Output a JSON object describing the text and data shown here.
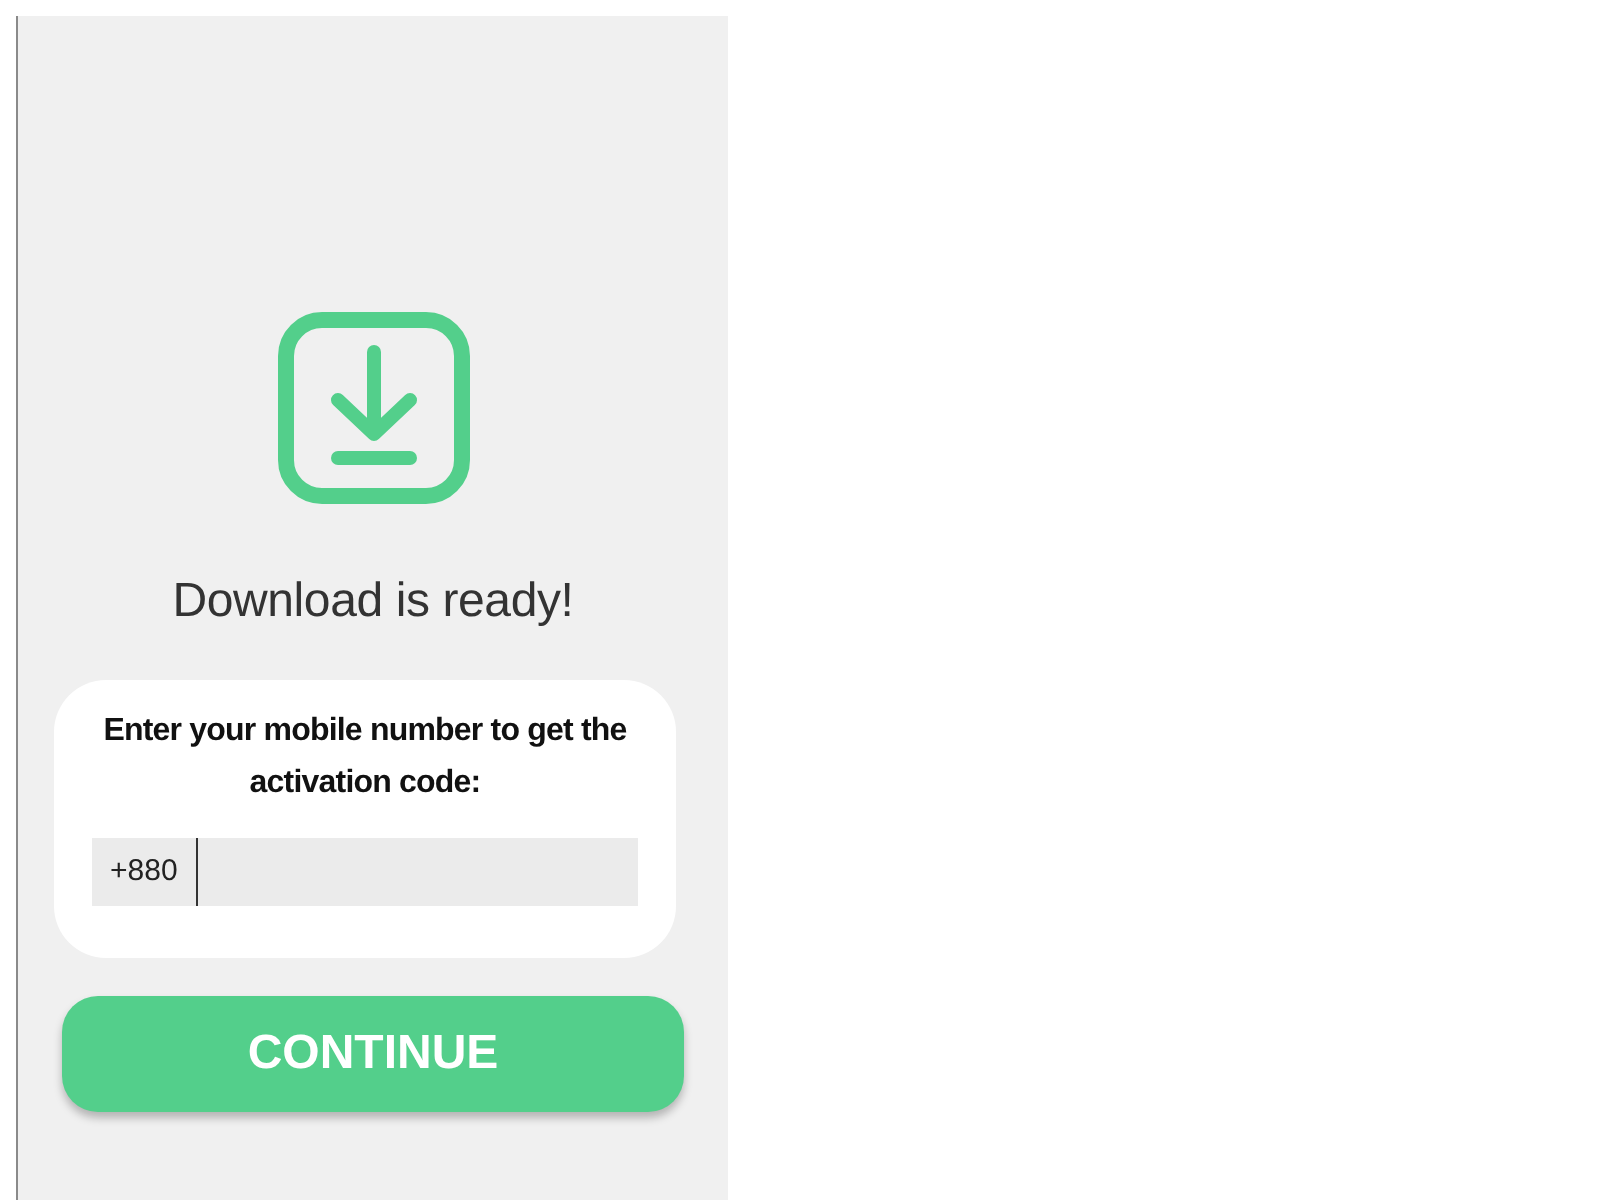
{
  "title": "Download is ready!",
  "form": {
    "prompt": "Enter your mobile number to get the activation code:",
    "phone_field": {
      "prefix": "+880"
    }
  },
  "button": {
    "label": "CONTINUE"
  }
}
